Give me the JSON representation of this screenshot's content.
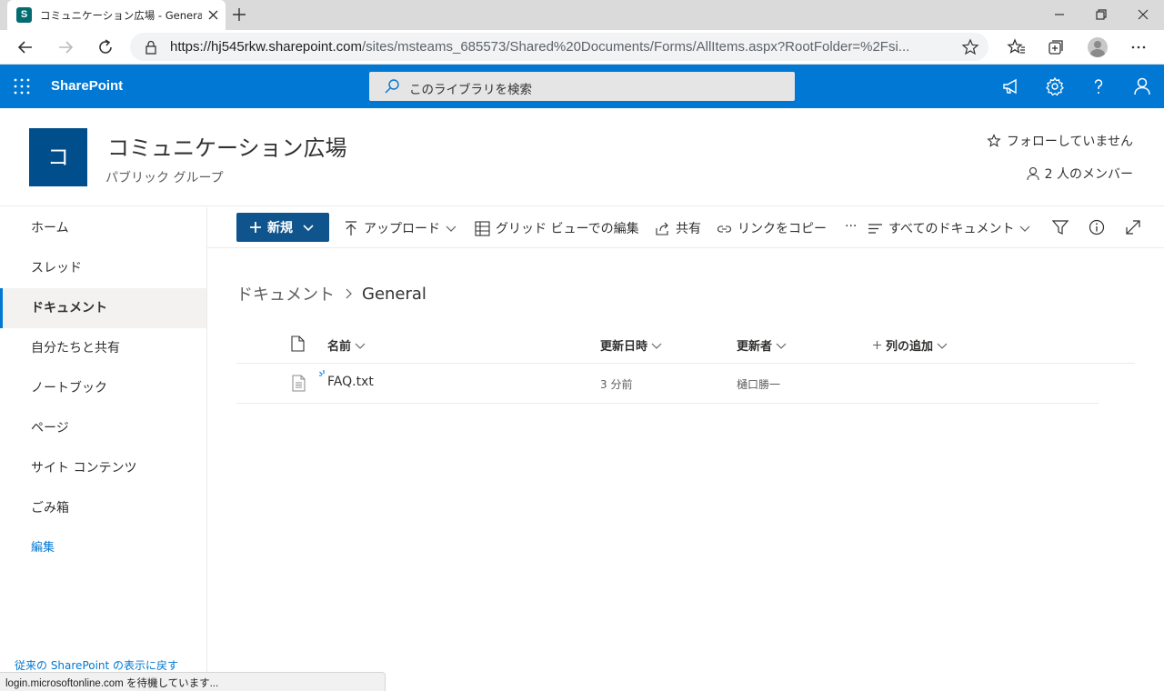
{
  "browser": {
    "tab_title": "コミュニケーション広場 - General - す",
    "tab_favicon_letter": "S",
    "url_main": "https://hj545rkw.sharepoint.com",
    "url_rest": "/sites/msteams_685573/Shared%20Documents/Forms/AllItems.aspx?RootFolder=%2Fsi..."
  },
  "suitebar": {
    "brand": "SharePoint",
    "search_placeholder": "このライブラリを検索"
  },
  "site": {
    "logo_letter": "コ",
    "title": "コミュニケーション広場",
    "subtitle": "パブリック グループ",
    "follow_label": "フォローしていません",
    "members_label": "2 人のメンバー"
  },
  "nav": {
    "items": [
      "ホーム",
      "スレッド",
      "ドキュメント",
      "自分たちと共有",
      "ノートブック",
      "ページ",
      "サイト コンテンツ",
      "ごみ箱"
    ],
    "edit_label": "編集",
    "classic_link": "従来の SharePoint の表示に戻す"
  },
  "commandbar": {
    "new_label": "新規",
    "upload_label": "アップロード",
    "grid_edit_label": "グリッド ビューでの編集",
    "share_label": "共有",
    "copy_link_label": "リンクをコピー",
    "more_label": "···",
    "view_label": "すべてのドキュメント"
  },
  "breadcrumb": {
    "parent": "ドキュメント",
    "current": "General"
  },
  "list": {
    "columns": {
      "name": "名前",
      "modified": "更新日時",
      "modified_by": "更新者",
      "add_column": "列の追加"
    },
    "rows": [
      {
        "name": "FAQ.txt",
        "modified": "3 分前",
        "modified_by": "樋口勝一"
      }
    ]
  },
  "status_bar": "login.microsoftonline.com を待機しています..."
}
